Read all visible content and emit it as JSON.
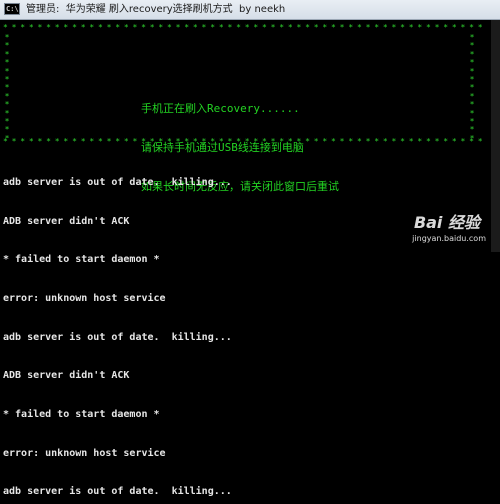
{
  "window": {
    "icon_text": "C:\\",
    "title": "管理员:  华为荣耀 刷入recovery选择刷机方式  by neekh"
  },
  "banner": {
    "star_row": "* * * * * * * * * * * * * * * * * * * * * * * * * * * * * * * * * * * * * * * * * * * * * * * * * * * * * * * * * * * * * * * * * * * * * * * * * * * * * * * * * * * * * * * * * * * * * * * * * * * * * * * * * * * * * * * * * * * * * * * * * * * * * * * * * * * *",
    "star_col": "*\n*\n*\n*\n*\n*\n*\n*\n*\n*\n*\n*\n*",
    "line1": "手机正在刷入Recovery......",
    "line2": "请保持手机通过USB线连接到电脑",
    "line3": "如果长时间无反应，请关闭此窗口后重试"
  },
  "log": [
    "adb server is out of date.  killing...",
    "ADB server didn't ACK",
    "* failed to start daemon *",
    "error: unknown host service",
    "adb server is out of date.  killing...",
    "ADB server didn't ACK",
    "* failed to start daemon *",
    "error: unknown host service",
    "adb server is out of date.  killing..."
  ],
  "watermark": {
    "logo": "Bai 经验",
    "url": "jingyan.baidu.com"
  },
  "colors": {
    "banner_green": "#2fd32f",
    "console_bg": "#000000",
    "log_text": "#e6e6e6"
  }
}
